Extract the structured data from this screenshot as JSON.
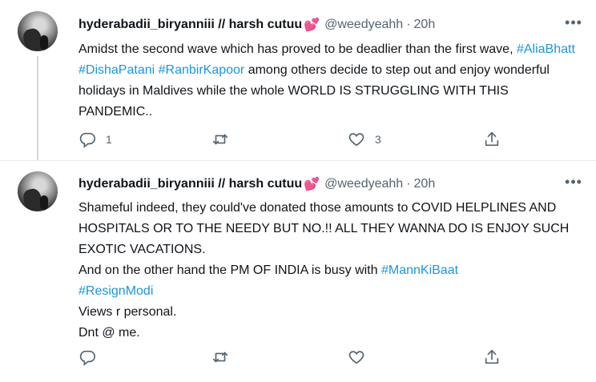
{
  "tweets": [
    {
      "display_name": "hyderabadii_biryanniii // harsh cutuu",
      "emoji": "💕",
      "handle": "@weedyeahh",
      "separator": "·",
      "time": "20h",
      "more": "•••",
      "text": {
        "part1": "Amidst the second wave which has proved to be deadlier than the first wave, ",
        "hashtag1": "#AliaBhatt",
        "hashtag2": "#DishaPatani",
        "hashtag3": "#RanbirKapoor",
        "part2": " among others decide to step out and enjoy wonderful holidays in Maldives while the whole WORLD IS STRUGGLING WITH THIS PANDEMIC.."
      },
      "actions": {
        "replies": "1",
        "retweets": "",
        "likes": "3"
      }
    },
    {
      "display_name": "hyderabadii_biryanniii // harsh cutuu",
      "emoji": "💕",
      "handle": "@weedyeahh",
      "separator": "·",
      "time": "20h",
      "more": "•••",
      "text": {
        "line1": "Shameful indeed, they could've donated those amounts to COVID HELPLINES AND HOSPITALS OR TO THE NEEDY BUT NO.!! ALL THEY WANNA DO IS ENJOY SUCH EXOTIC VACATIONS.",
        "line2": "And on the other hand the PM OF INDIA is busy with ",
        "hashtag1": "#MannKiBaat",
        "hashtag2": "#ResignModi",
        "line3": "Views r personal.",
        "line4": "Dnt @ me."
      },
      "actions": {
        "replies": "",
        "retweets": "",
        "likes": ""
      }
    }
  ],
  "icons": [
    "reply-icon",
    "retweet-icon",
    "like-icon",
    "share-icon",
    "more-icon"
  ],
  "colors": {
    "hashtag": "#1b95e0",
    "secondary_text": "#536471",
    "primary_text": "#0f1419",
    "divider": "#e6ecf0"
  }
}
